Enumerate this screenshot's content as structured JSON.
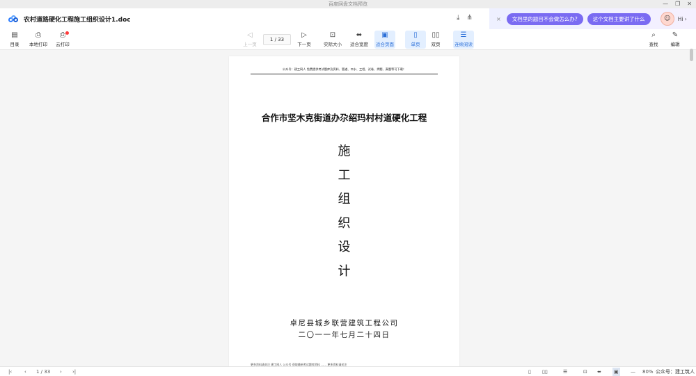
{
  "window": {
    "title": "百度网盘文档预览",
    "controls": [
      "—",
      "❐",
      "✕"
    ]
  },
  "file": {
    "name": "农村道路硬化工程施工组织设计1.doc",
    "actions": [
      {
        "name": "download-icon",
        "glyph": "⤓"
      },
      {
        "name": "share-icon",
        "glyph": "⋔"
      }
    ]
  },
  "ai_assistant": {
    "close": "×",
    "chips": [
      "文档里的题目不会做怎么办?",
      "这个文档主要讲了什么"
    ],
    "avatar": "☺",
    "greeting": "Hi ›"
  },
  "toolbar": {
    "left": [
      {
        "key": "toc",
        "label": "目录",
        "icon": "▤"
      },
      {
        "key": "local_print",
        "label": "本地打印",
        "icon": "⎙"
      },
      {
        "key": "cloud_print",
        "label": "云打印",
        "icon": "⎙"
      }
    ],
    "prev": {
      "label": "上一页",
      "icon": "◁"
    },
    "page_indicator": "1 / 33",
    "next": {
      "label": "下一页",
      "icon": "▷"
    },
    "view": [
      {
        "key": "actual_size",
        "label": "实际大小",
        "icon": "⊡"
      },
      {
        "key": "fit_width",
        "label": "适合宽度",
        "icon": "⬌"
      },
      {
        "key": "fit_page",
        "label": "适合页面",
        "icon": "▣",
        "active": true
      },
      {
        "key": "single_page",
        "label": "单页",
        "icon": "▯",
        "active": true
      },
      {
        "key": "double_page",
        "label": "双页",
        "icon": "▯▯"
      },
      {
        "key": "continuous",
        "label": "连续阅读",
        "icon": "☰",
        "active": true
      }
    ],
    "right": [
      {
        "key": "find",
        "label": "查找",
        "icon": "⌕"
      },
      {
        "key": "edit",
        "label": "编辑",
        "icon": "✎"
      }
    ]
  },
  "document": {
    "header_line": "公众号：建工网人 免费提供考试题库及资料、管道、口水、工程、试卷、押题、真题等可下载！",
    "title": "合作市坚木克街道办尕绍玛村村道硬化工程",
    "vertical_chars": [
      "施",
      "工",
      "组",
      "织",
      "设",
      "计"
    ],
    "company": "卓尼县城乡联营建筑工程公司",
    "date": "二〇一一年七月二十四日",
    "footer_text": "更多资料请关注 建工网人 公众号 获取最新考试题库资料 ……  更多资料请关注"
  },
  "statusbar": {
    "nav": [
      "|‹",
      "‹",
      "1 / 33",
      "›",
      "›|"
    ],
    "view_icons": [
      "▯",
      "▯▯",
      "☰",
      "⊡",
      "⬌",
      "▣"
    ],
    "zoom_out": "—",
    "zoom": "80%",
    "zoom_in": "+",
    "watermark": "公众号：建工筑人"
  }
}
